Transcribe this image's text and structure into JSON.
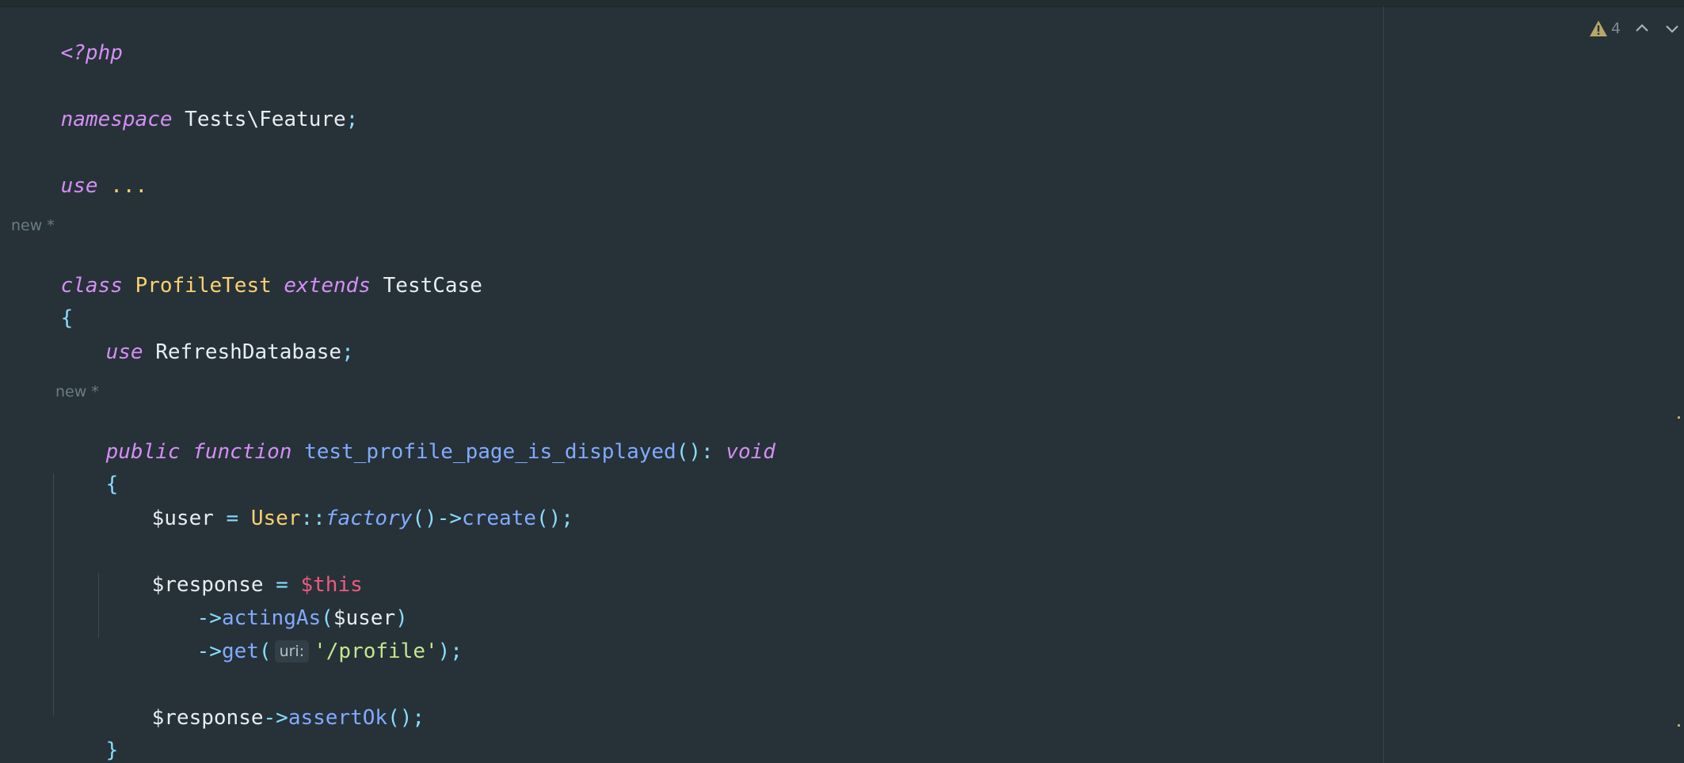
{
  "editor": {
    "lines": {
      "php_open": "<?php",
      "namespace_kw": "namespace",
      "namespace_name": "Tests\\Feature",
      "semicolon": ";",
      "use_kw": "use",
      "use_fold": "...",
      "class_kw": "class",
      "class_name": "ProfileTest",
      "extends_kw": "extends",
      "parent_class": "TestCase",
      "open_brace": "{",
      "close_brace": "}",
      "trait_use_kw": "use",
      "trait_name": "RefreshDatabase",
      "public_kw": "public",
      "function_kw": "function",
      "method_name": "test_profile_page_is_displayed",
      "method_parens": "()",
      "colon": ":",
      "return_type": "void",
      "user_var": "$user",
      "assign": " = ",
      "user_class": "User",
      "double_colon": "::",
      "factory": "factory",
      "parens": "()",
      "arrow": "->",
      "create": "create",
      "call_end": "();",
      "response_var": "$response",
      "this_var": "$this",
      "acting_as": "actingAs",
      "open_paren": "(",
      "close_paren": ")",
      "get": "get",
      "uri_hint": "uri:",
      "profile_str": "'/profile'",
      "call_close": ");",
      "assert_ok": "assertOk"
    },
    "hints": {
      "class_new": "new *",
      "method_new": "new *"
    },
    "status": {
      "warning_count": "4",
      "warning_icon": "warning-icon",
      "prev_icon": "chevron-up-icon",
      "next_icon": "chevron-down-icon"
    }
  },
  "colors": {
    "background": "#263238",
    "keyword": "#d58ef5",
    "class": "#fcd171",
    "function": "#82aaff",
    "string": "#c3e88d",
    "this": "#f0597f"
  }
}
